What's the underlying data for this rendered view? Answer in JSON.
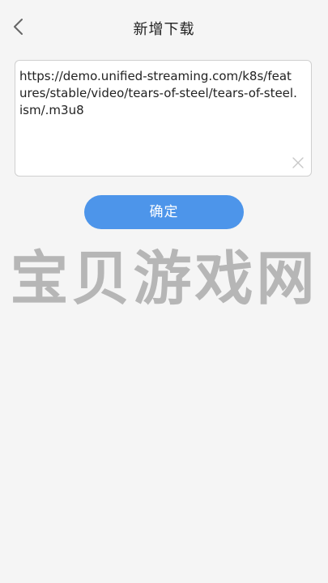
{
  "header": {
    "title": "新增下载",
    "back_icon": "chevron-left-icon"
  },
  "url_input": {
    "value": "https://demo.unified-streaming.com/k8s/features/stable/video/tears-of-steel/tears-of-steel.ism/.m3u8",
    "clear_icon": "close-icon"
  },
  "confirm_button": {
    "label": "确定",
    "color": "#4d95ea"
  },
  "watermark": {
    "text": "宝贝游戏网"
  }
}
